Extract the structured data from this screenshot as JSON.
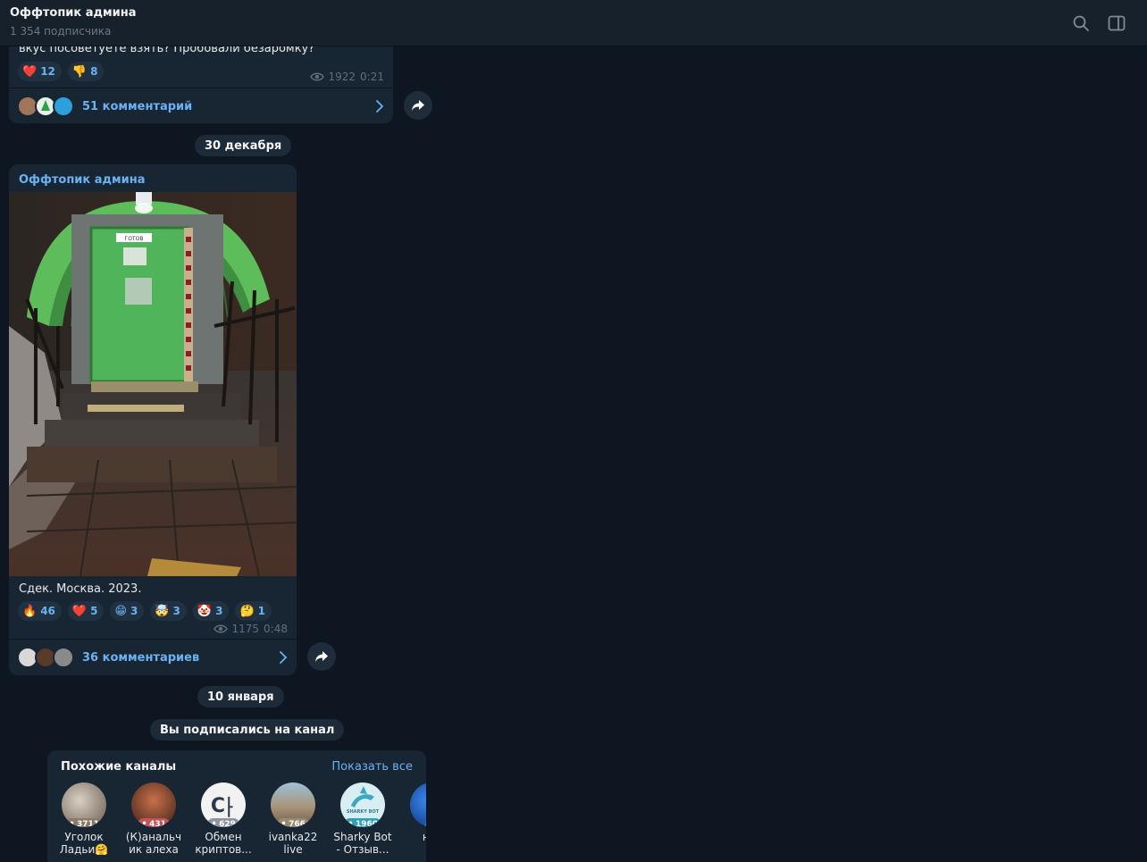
{
  "header": {
    "title": "Оффтопик админа",
    "subscribers": "1 354 подписчика"
  },
  "post1": {
    "text_tail": "вкус посоветуете взять? Пробовали безаромку?",
    "reactions": [
      {
        "emoji": "❤️",
        "count": "12"
      },
      {
        "emoji": "👎",
        "count": "8"
      }
    ],
    "views": "1922",
    "time": "0:21",
    "comments": "51 комментарий"
  },
  "date1": "30 декабря",
  "post2": {
    "author": "Оффтопик админа",
    "photo_sign": "ГОТОВ",
    "caption": "Сдек. Москва. 2023.",
    "reactions": [
      {
        "emoji": "🔥",
        "count": "46"
      },
      {
        "emoji": "❤️",
        "count": "5"
      },
      {
        "emoji": "😁",
        "count": "3"
      },
      {
        "emoji": "🤯",
        "count": "3"
      },
      {
        "emoji": "🤡",
        "count": "3"
      },
      {
        "emoji": "🤔",
        "count": "1"
      }
    ],
    "views": "1175",
    "time": "0:48",
    "comments": "36 комментариев"
  },
  "date2": "10 января",
  "service": "Вы подписались на канал",
  "similar": {
    "title": "Похожие каналы",
    "show_all": "Показать все",
    "channels": [
      {
        "name": "Уголок\nЛадьи🤗",
        "count": "3711",
        "badge_color": "#8a7a6a"
      },
      {
        "name": "(К)анальч\nик алеха",
        "count": "431",
        "badge_color": "#c0555c"
      },
      {
        "name": "Обмен\nкриптов...",
        "count": "629",
        "avatar_text": "C⸠",
        "badge_color": "#8d96a0"
      },
      {
        "name": "ivanka22\nlive",
        "count": "766",
        "badge_color": "#9a8a72"
      },
      {
        "name": "Sharky Bot\n- Отзыв...",
        "count": "1960",
        "avatar_text": "SHARKY BOT",
        "badge_color": "#2fa0b5"
      },
      {
        "name": "нот\nч",
        "count": "",
        "badge_color": "#2f6fd8"
      }
    ]
  }
}
